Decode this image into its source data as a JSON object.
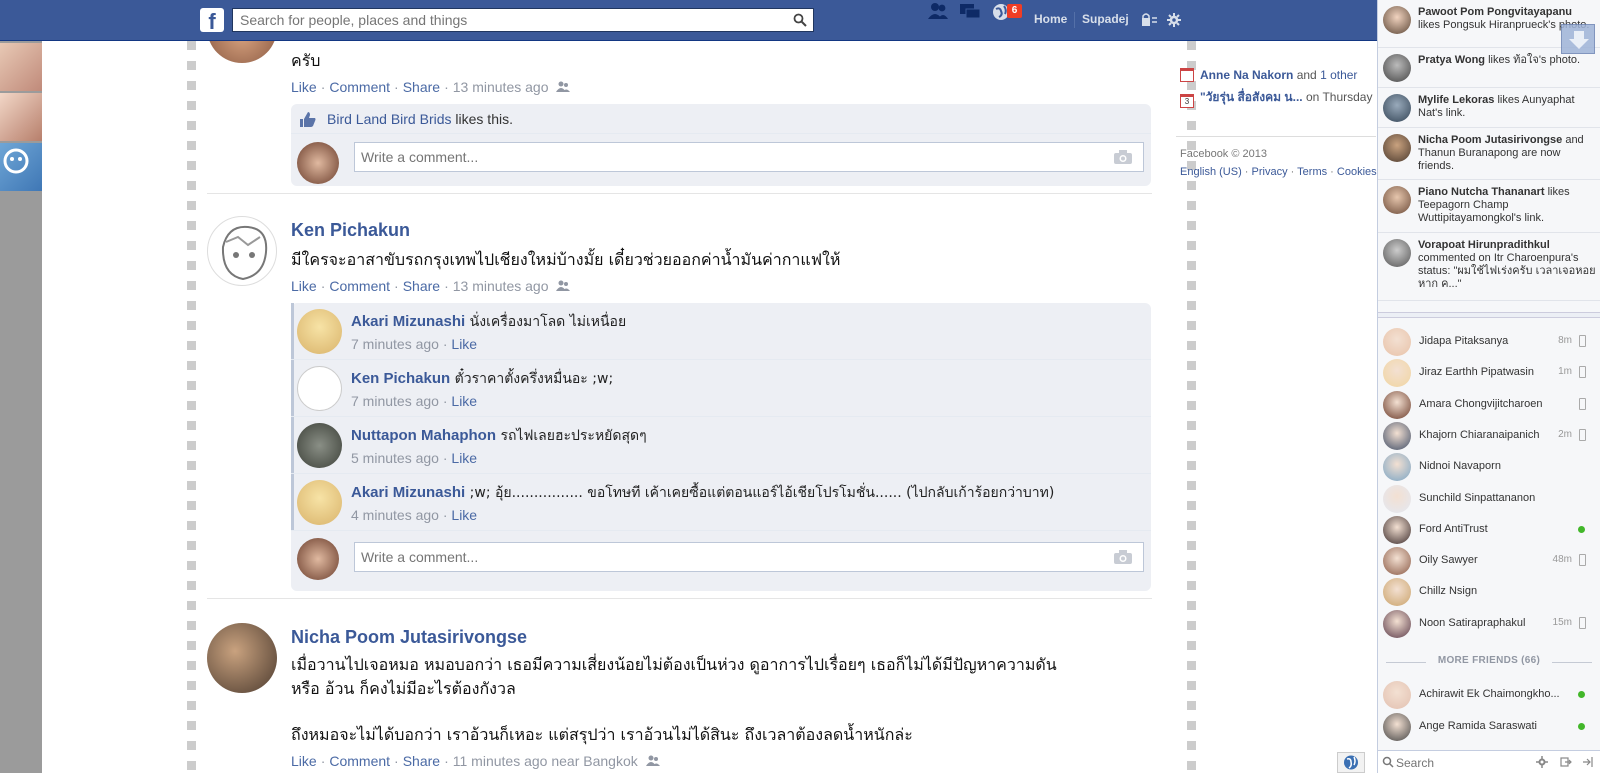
{
  "topbar": {
    "logo": "f",
    "search_placeholder": "Search for people, places and things",
    "notification_count": "6",
    "home_label": "Home",
    "profile_label": "Supadej"
  },
  "feed": {
    "story1": {
      "partial_text": "ครับ",
      "like": "Like",
      "comment": "Comment",
      "share": "Share",
      "time": "13 minutes ago",
      "likes_name": "Bird Land Bird Brids",
      "likes_suffix": " likes this.",
      "write_placeholder": "Write a comment..."
    },
    "story2": {
      "author": "Ken Pichakun",
      "text": "มีใครจะอาสาขับรถกรุงเทพไปเชียงใหม่บ้างมั้ย เดี๋ยวช่วยออกค่าน้ำมันค่ากาแฟให้",
      "like": "Like",
      "comment": "Comment",
      "share": "Share",
      "time": "13 minutes ago",
      "comments": [
        {
          "name": "Akari Mizunashi",
          "text": "นั่งเครื่องมาโลด ไม่เหนื่อย",
          "time": "7 minutes ago",
          "like": "Like"
        },
        {
          "name": "Ken Pichakun",
          "text": "ตั๋วราคาตั้งครึ่งหมื่นอะ ;w;",
          "time": "7 minutes ago",
          "like": "Like"
        },
        {
          "name": "Nuttapon Mahaphon",
          "text": "รถไฟเลยฮะประหยัดสุดๆ",
          "time": "5 minutes ago",
          "like": "Like"
        },
        {
          "name": "Akari Mizunashi",
          "text": ";w; อุ้ย................ ขอโทษที เค้าเคยซื้อแต่ตอนแอร์ไอ้เชียโปรโมชั่น...... (ไปกลับเก้าร้อยกว่าบาท)",
          "time": "4 minutes ago",
          "like": "Like"
        }
      ],
      "write_placeholder": "Write a comment..."
    },
    "story3": {
      "author": "Nicha Poom Jutasirivongse",
      "text1": "เมื่อวานไปเจอหมอ หมอบอกว่า เธอมีความเสี่ยงน้อยไม่ต้องเป็นห่วง ดูอาการไปเรื่อยๆ เธอก็ไม่ได้มีปัญหาความดัน",
      "text2": "หรือ อ้วน ก็คงไม่มีอะไรต้องกังวล",
      "text3": "ถึงหมอจะไม่ได้บอกว่า เราอ้วนก็เหอะ แต่สรุปว่า เราอ้วนไม่ได้สินะ ถึงเวลาต้องลดน้ำหนักล่ะ",
      "like": "Like",
      "comment": "Comment",
      "share": "Share",
      "time": "11 minutes ago near Bangkok"
    }
  },
  "right_column": {
    "event1_name": "Anne Na Nakorn",
    "event1_and": " and ",
    "event1_other": "1 other",
    "event2_name": "\"วัยรุ่น สื่อสังคม น...",
    "event2_when": " on Thursday",
    "event2_day": "3",
    "copyright": "Facebook © 2013",
    "footer_links": [
      "English (US)",
      "Privacy",
      "Terms",
      "Cookies"
    ]
  },
  "ticker": [
    {
      "name": "Pawoot Pom Pongvitayapanu",
      "text": " likes Pongsuk Hiranprueck's photo."
    },
    {
      "name": "Pratya Wong",
      "text": " likes ท้อใจ's photo."
    },
    {
      "name": "Mylife Lekoras",
      "text": " likes Aunyaphat Nat's link."
    },
    {
      "name": "Nicha Poom Jutasirivongse",
      "text": " and Thanun Buranapong are now friends."
    },
    {
      "name": "Piano Nutcha Thananart",
      "text": " likes Teepagorn Champ Wuttipitayamongkol's link."
    },
    {
      "name": "Vorapoat Hirunpradithkul",
      "text": " commented on Itr Charoenpura's status: \"ผมใช้ไฟเร่งครับ เวลาเจอหอยหาก ค...\""
    }
  ],
  "chat": {
    "friends": [
      {
        "name": "Jidapa Pitaksanya",
        "time": "8m",
        "status": "mobile"
      },
      {
        "name": "Jiraz Earthh Pipatwasin",
        "time": "1m",
        "status": "mobile"
      },
      {
        "name": "Amara Chongvijitcharoen",
        "time": "",
        "status": "mobile"
      },
      {
        "name": "Khajorn Chiaranaipanich",
        "time": "2m",
        "status": "mobile"
      },
      {
        "name": "Nidnoi Navaporn",
        "time": "",
        "status": "none"
      },
      {
        "name": "Sunchild Sinpattananon",
        "time": "",
        "status": "none"
      },
      {
        "name": "Ford AntiTrust",
        "time": "",
        "status": "online"
      },
      {
        "name": "Oily Sawyer",
        "time": "48m",
        "status": "mobile"
      },
      {
        "name": "Chillz Nsign",
        "time": "",
        "status": "none"
      },
      {
        "name": "Noon Satirapraphakul",
        "time": "15m",
        "status": "mobile"
      }
    ],
    "more_friends": "MORE FRIENDS (66)",
    "more": [
      {
        "name": "Achirawit Ek Chaimongkho...",
        "status": "online"
      },
      {
        "name": "Ange Ramida Saraswati",
        "status": "online"
      }
    ],
    "search_placeholder": "Search"
  },
  "colors": {
    "brand": "#3b5998",
    "online": "#42b72a",
    "badge": "#f03d25"
  }
}
